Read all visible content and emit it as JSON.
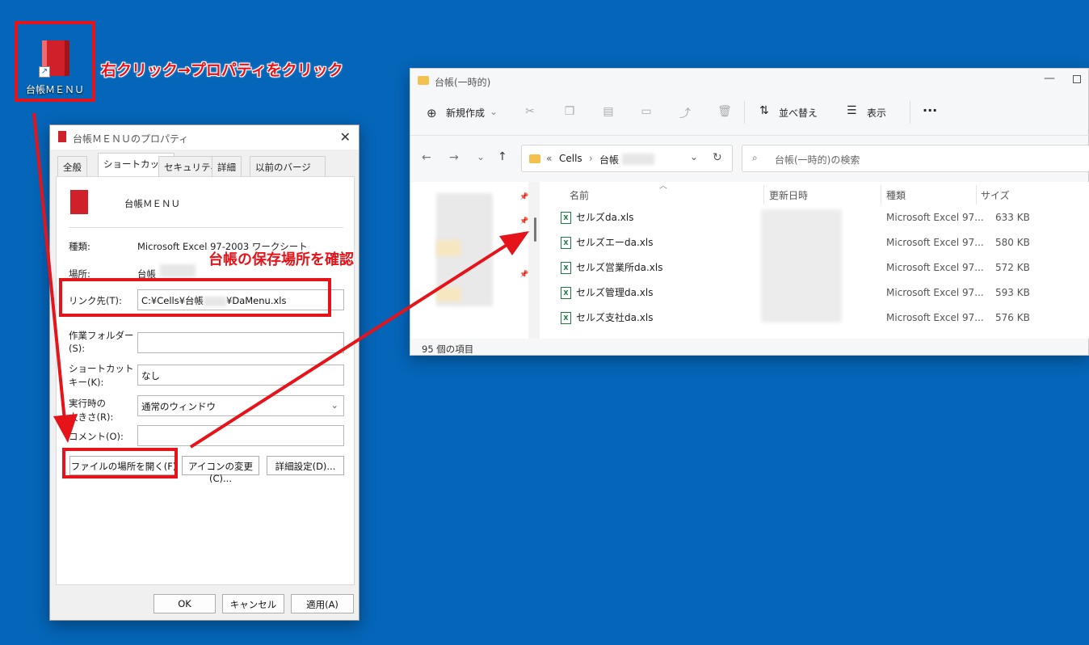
{
  "desktop": {
    "icon_label": "台帳ＭＥＮＵ",
    "callout_right_click": "右クリック→プロパティをクリック",
    "callout_location": "台帳の保存場所を確認"
  },
  "properties": {
    "title": "台帳ＭＥＮＵのプロパティ",
    "tabs": [
      "全般",
      "ショートカット",
      "セキュリティ",
      "詳細",
      "以前のバージョン"
    ],
    "name": "台帳ＭＥＮＵ",
    "type_label": "種類:",
    "type_value": "Microsoft Excel 97-2003 ワークシート",
    "location_label": "場所:",
    "location_value": "台帳",
    "link_label": "リンク先(T):",
    "link_value": "C:¥Cells¥台帳",
    "link_value_tail": "¥DaMenu.xls",
    "workdir_label_1": "作業フォルダー",
    "workdir_label_2": "(S):",
    "shortcut_label_1": "ショートカット",
    "shortcut_label_2": "キー(K):",
    "shortcut_value": "なし",
    "run_label_1": "実行時の",
    "run_label_2": "大きさ(R):",
    "run_value": "通常のウィンドウ",
    "comment_label": "コメント(O):",
    "btn_open_location": "ファイルの場所を開く(F)",
    "btn_change_icon": "アイコンの変更(C)...",
    "btn_advanced": "詳細設定(D)...",
    "btn_ok": "OK",
    "btn_cancel": "キャンセル",
    "btn_apply": "適用(A)"
  },
  "explorer": {
    "title": "台帳(一時的)",
    "new_label": "新規作成",
    "sort_label": "並べ替え",
    "view_label": "表示",
    "more_label": "···",
    "path_cells": "Cells",
    "path_ledger": "台帳",
    "search_placeholder": "台帳(一時的)の検索",
    "columns": {
      "name": "名前",
      "modified": "更新日時",
      "type": "種類",
      "size": "サイズ"
    },
    "files": [
      {
        "name": "セルズda.xls",
        "type": "Microsoft Excel 97...",
        "size": "633 KB"
      },
      {
        "name": "セルズエーda.xls",
        "type": "Microsoft Excel 97...",
        "size": "580 KB"
      },
      {
        "name": "セルズ営業所da.xls",
        "type": "Microsoft Excel 97...",
        "size": "572 KB"
      },
      {
        "name": "セルズ管理da.xls",
        "type": "Microsoft Excel 97...",
        "size": "593 KB"
      },
      {
        "name": "セルズ支社da.xls",
        "type": "Microsoft Excel 97...",
        "size": "576 KB"
      }
    ],
    "status": "95 個の項目"
  }
}
